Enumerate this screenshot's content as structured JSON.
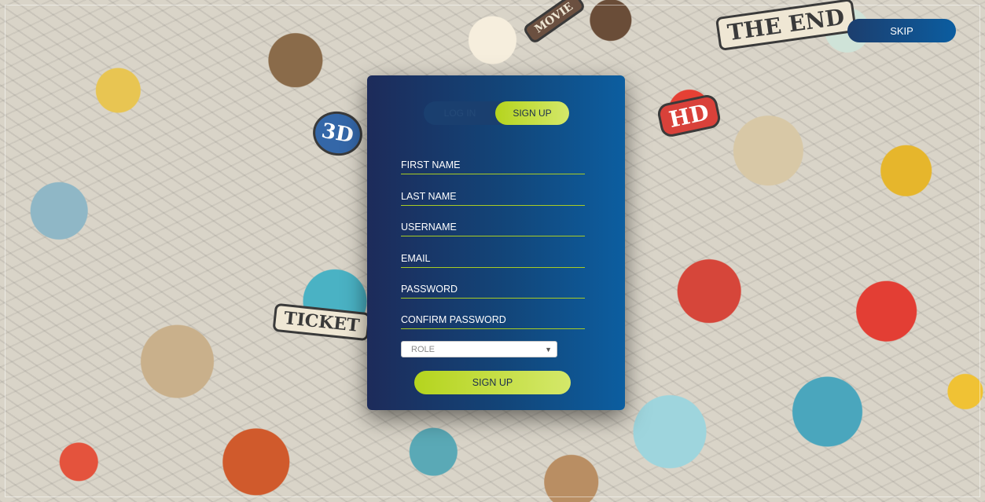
{
  "header": {
    "skip_label": "SKIP"
  },
  "background": {
    "words": {
      "ticket": "TICKET",
      "the_end": "THE END",
      "movie": "MOVIE",
      "hd": "HD",
      "three_d": "3D"
    }
  },
  "auth": {
    "toggle": {
      "login_label": "LOG IN",
      "signup_label": "SIGN UP",
      "active": "SIGN UP"
    },
    "fields": {
      "first_name": {
        "placeholder": "FIRST NAME",
        "value": ""
      },
      "last_name": {
        "placeholder": "LAST NAME",
        "value": ""
      },
      "username": {
        "placeholder": "USERNAME",
        "value": ""
      },
      "email": {
        "placeholder": "EMAIL",
        "value": ""
      },
      "password": {
        "placeholder": "PASSWORD",
        "value": ""
      },
      "confirm_password": {
        "placeholder": "CONFIRM PASSWORD",
        "value": ""
      }
    },
    "role": {
      "selected": "ROLE"
    },
    "submit_label": "SIGN UP"
  },
  "colors": {
    "accent_green": "#b5d41e",
    "card_dark_blue": "#1d2b5a",
    "card_light_blue": "#0c5ea0",
    "field_underline": "#a9cc24"
  }
}
